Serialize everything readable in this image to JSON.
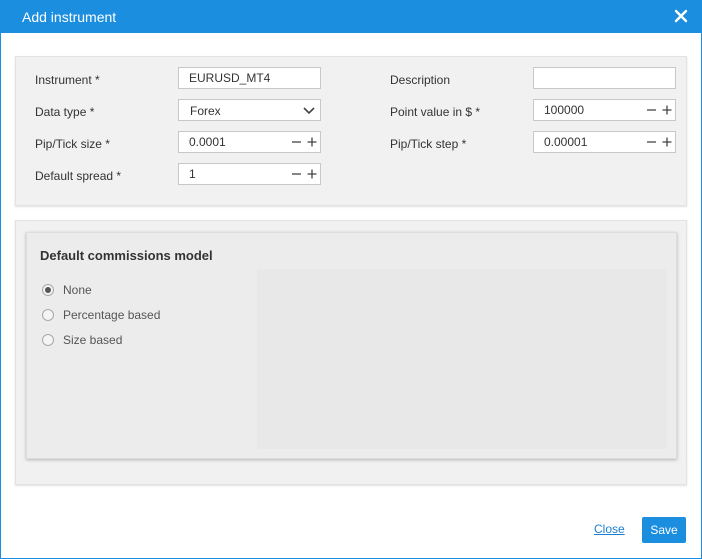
{
  "dialog": {
    "title": "Add instrument"
  },
  "form": {
    "instrument": {
      "label": "Instrument *",
      "value": "EURUSD_MT4"
    },
    "data_type": {
      "label": "Data type *",
      "value": "Forex"
    },
    "pip_tick_size": {
      "label": "Pip/Tick size *",
      "value": "0.0001"
    },
    "default_spread": {
      "label": "Default spread *",
      "value": "1"
    },
    "description": {
      "label": "Description",
      "value": ""
    },
    "point_value": {
      "label": "Point value in $ *",
      "value": "100000"
    },
    "pip_tick_step": {
      "label": "Pip/Tick step *",
      "value": "0.00001"
    }
  },
  "commissions": {
    "title": "Default commissions model",
    "options": [
      {
        "label": "None",
        "selected": true
      },
      {
        "label": "Percentage based",
        "selected": false
      },
      {
        "label": "Size based",
        "selected": false
      }
    ]
  },
  "footer": {
    "close_label": "Close",
    "save_label": "Save"
  },
  "colors": {
    "accent": "#1b8ee0",
    "link": "#1b7fd4",
    "panel": "#f1f1f1"
  },
  "icons": {
    "close": "close-icon",
    "dropdown": "chevron-down-icon",
    "minus": "minus-icon",
    "plus": "plus-icon"
  }
}
